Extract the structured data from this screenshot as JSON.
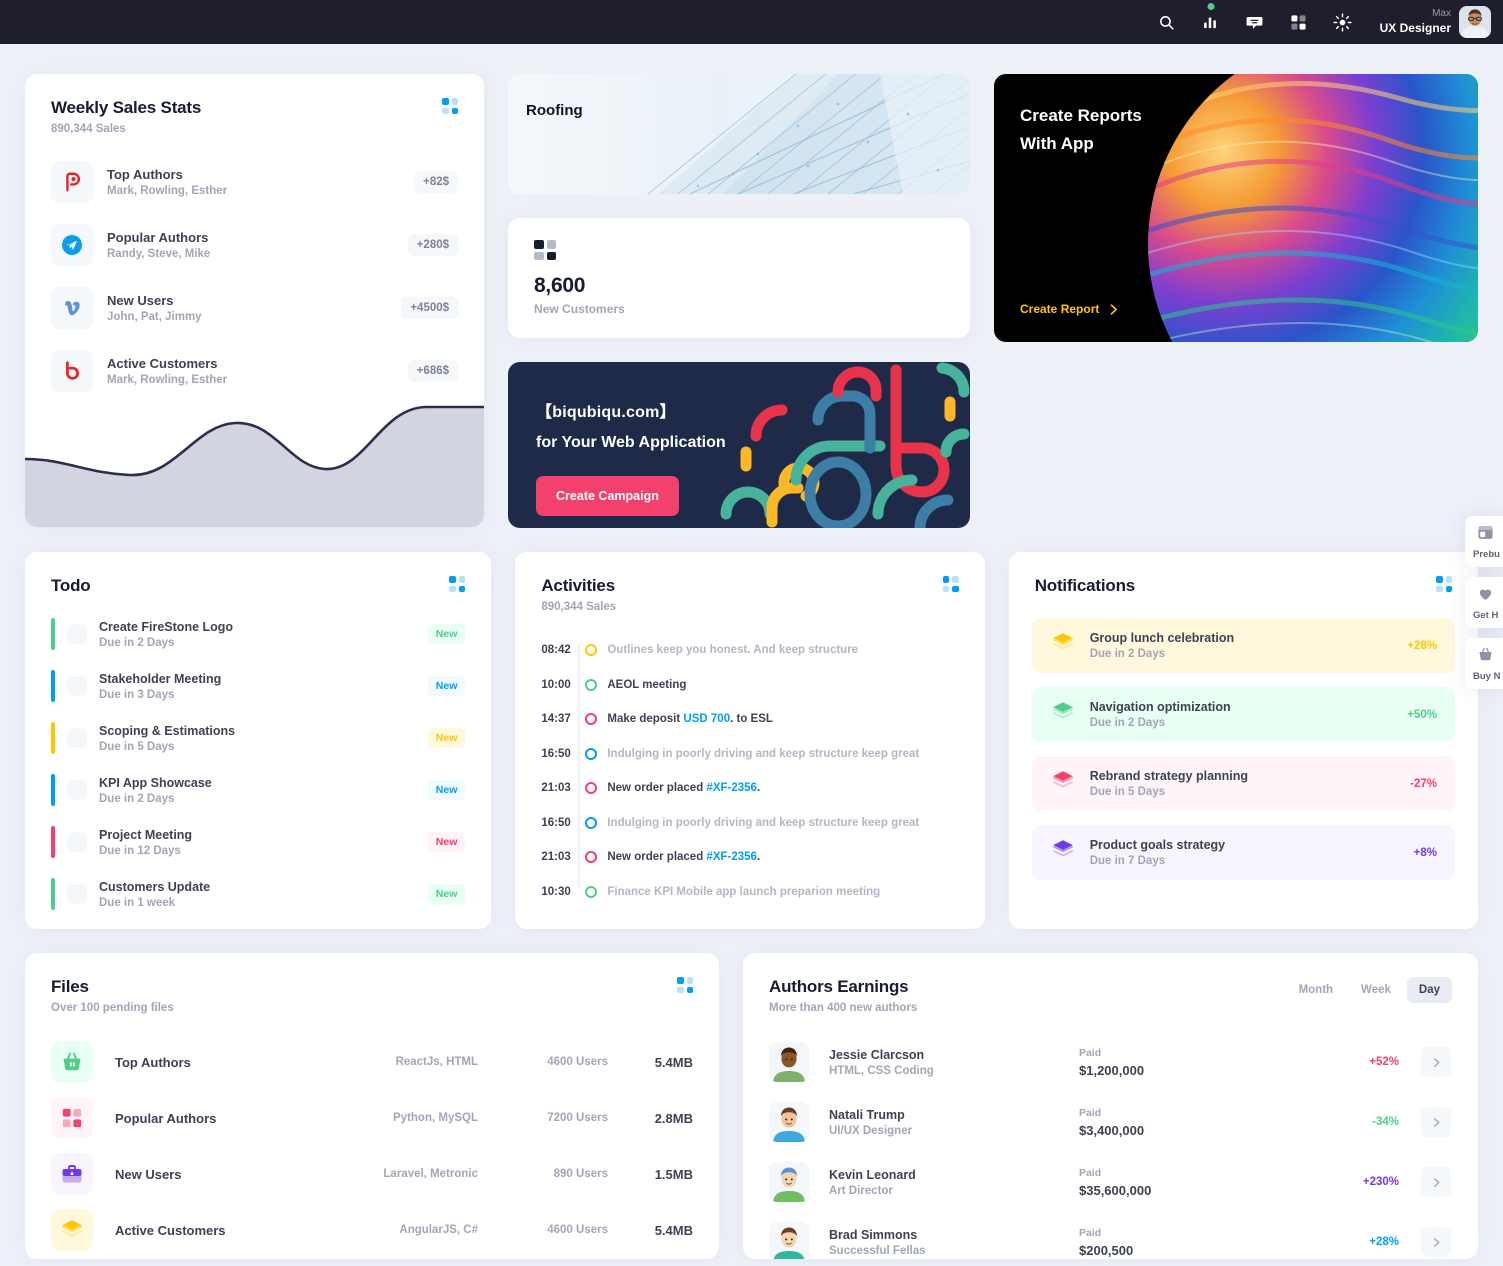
{
  "header": {
    "icons": [
      "search-icon",
      "bar-chart-icon",
      "chat-bubble-icon",
      "grid-icon",
      "brightness-icon"
    ],
    "greeting": "Max",
    "role": "UX Designer"
  },
  "weekly_sales": {
    "title": "Weekly Sales Stats",
    "subtitle": "890,344 Sales",
    "menu_icon": "grid-dots-icon",
    "items": [
      {
        "icon": "plurk-icon",
        "name": "Top Authors",
        "people": "Mark, Rowling, Esther",
        "amount": "+82$"
      },
      {
        "icon": "telegram-icon",
        "name": "Popular Authors",
        "people": "Randy, Steve, Mike",
        "amount": "+280$"
      },
      {
        "icon": "vimeo-icon",
        "name": "New Users",
        "people": "John, Pat, Jimmy",
        "amount": "+4500$"
      },
      {
        "icon": "bebo-icon",
        "name": "Active Customers",
        "people": "Mark, Rowling, Esther",
        "amount": "+686$"
      }
    ],
    "chart_data": {
      "type": "area",
      "title": "Weekly Sales Stats",
      "x": [
        0,
        1,
        2,
        3,
        4,
        5,
        6,
        7,
        8
      ],
      "values": [
        42,
        37,
        31,
        48,
        62,
        55,
        38,
        44,
        78
      ],
      "stroke_color": "#2b2f4c",
      "fill_color": "#d2d4e0",
      "grid": false,
      "xlabel": "",
      "ylabel": "",
      "ylim": [
        0,
        100
      ]
    }
  },
  "roofing": {
    "title": "Roofing",
    "image": "glass-building-facade"
  },
  "new_customers": {
    "icon": "checker-grid-icon",
    "value": "8,600",
    "label": "New Customers"
  },
  "reports": {
    "line1": "Create Reports",
    "line2": "With App",
    "cta": "Create Report",
    "cta_icon": "arrow-right-icon",
    "accent": "#ffc700",
    "image": "iridescent-sphere"
  },
  "campaign": {
    "line1": "【biqubiqu.com】",
    "line2": "for Your Web Application",
    "button": "Create Campaign",
    "button_color": "#f1416c",
    "bg_color": "#1e2a47"
  },
  "todo": {
    "title": "Todo",
    "menu_icon": "grid-dots-icon",
    "items": [
      {
        "name": "Create FireStone Logo",
        "due": "Due in 2 Days",
        "badge": "New",
        "color": "#50cd89"
      },
      {
        "name": "Stakeholder Meeting",
        "due": "Due in 3 Days",
        "badge": "New",
        "color": "#009ef7"
      },
      {
        "name": "Scoping & Estimations",
        "due": "Due in 5 Days",
        "badge": "New",
        "color": "#ffc700"
      },
      {
        "name": "KPI App Showcase",
        "due": "Due in 2 Days",
        "badge": "New",
        "color": "#009ef7"
      },
      {
        "name": "Project Meeting",
        "due": "Due in 12 Days",
        "badge": "New",
        "color": "#f1416c"
      },
      {
        "name": "Customers Update",
        "due": "Due in 1 week",
        "badge": "New",
        "color": "#50cd89"
      }
    ]
  },
  "activities": {
    "title": "Activities",
    "subtitle": "890,344 Sales",
    "menu_icon": "grid-dots-icon",
    "items": [
      {
        "time": "08:42",
        "color": "#ffc700",
        "text": "Outlines keep you honest. And keep structure",
        "muted": true
      },
      {
        "time": "10:00",
        "color": "#50cd89",
        "text": "AEOL meeting",
        "muted": false
      },
      {
        "time": "14:37",
        "color": "#f1416c",
        "text": "Make deposit USD 700. to ESL",
        "muted": false,
        "link": "USD 700"
      },
      {
        "time": "16:50",
        "color": "#009ef7",
        "text": "Indulging in poorly driving and keep structure keep great",
        "muted": true
      },
      {
        "time": "21:03",
        "color": "#f1416c",
        "text": "New order placed #XF-2356.",
        "muted": false,
        "link": "#XF-2356"
      },
      {
        "time": "16:50",
        "color": "#009ef7",
        "text": "Indulging in poorly driving and keep structure keep great",
        "muted": true
      },
      {
        "time": "21:03",
        "color": "#f1416c",
        "text": "New order placed #XF-2356.",
        "muted": false,
        "link": "#XF-2356"
      },
      {
        "time": "10:30",
        "color": "#50cd89",
        "text": "Finance KPI Mobile app launch preparion meeting",
        "muted": true
      }
    ]
  },
  "notifications": {
    "title": "Notifications",
    "menu_icon": "grid-dots-icon",
    "items": [
      {
        "icon": "layers-icon",
        "name": "Group lunch celebration",
        "due": "Due in 2 Days",
        "pct": "+28%",
        "color": "#ffc700",
        "bg": "#fff8dd"
      },
      {
        "icon": "layers-icon",
        "name": "Navigation optimization",
        "due": "Due in 2 Days",
        "pct": "+50%",
        "color": "#50cd89",
        "bg": "#e8fff3"
      },
      {
        "icon": "layers-icon",
        "name": "Rebrand strategy planning",
        "due": "Due in 5 Days",
        "pct": "-27%",
        "color": "#f1416c",
        "bg": "#fff5f8"
      },
      {
        "icon": "layers-icon",
        "name": "Product goals strategy",
        "due": "Due in 7 Days",
        "pct": "+8%",
        "color": "#7239ea",
        "bg": "#f8f5ff"
      }
    ]
  },
  "files": {
    "title": "Files",
    "subtitle": "Over 100 pending files",
    "menu_icon": "grid-dots-icon",
    "items": [
      {
        "icon": "basket-icon",
        "name": "Top Authors",
        "tech": "ReactJs, HTML",
        "users": "4600 Users",
        "size": "5.4MB",
        "color": "#50cd89",
        "bg": "#e8fff3"
      },
      {
        "icon": "grid-icon",
        "name": "Popular Authors",
        "tech": "Python, MySQL",
        "users": "7200 Users",
        "size": "2.8MB",
        "color": "#f1416c",
        "bg": "#fff5f8"
      },
      {
        "icon": "briefcase-icon",
        "name": "New Users",
        "tech": "Laravel, Metronic",
        "users": "890 Users",
        "size": "1.5MB",
        "color": "#7239ea",
        "bg": "#f8f5ff"
      },
      {
        "icon": "layers-icon",
        "name": "Active Customers",
        "tech": "AngularJS, C#",
        "users": "4600 Users",
        "size": "5.4MB",
        "color": "#ffc700",
        "bg": "#fff8dd"
      }
    ]
  },
  "authors": {
    "title": "Authors Earnings",
    "subtitle": "More than 400 new authors",
    "tabs": [
      "Month",
      "Week",
      "Day"
    ],
    "active_tab": "Day",
    "paid_label": "Paid",
    "items": [
      {
        "avatar": "avatar-woman-dark",
        "name": "Jessie Clarcson",
        "role": "HTML, CSS Coding",
        "paid": "$1,200,000",
        "pct": "+52%",
        "pct_color": "#f1416c"
      },
      {
        "avatar": "avatar-woman-brown",
        "name": "Natali Trump",
        "role": "UI/UX Designer",
        "paid": "$3,400,000",
        "pct": "-34%",
        "pct_color": "#50cd89"
      },
      {
        "avatar": "avatar-man-blue",
        "name": "Kevin Leonard",
        "role": "Art Director",
        "paid": "$35,600,000",
        "pct": "+230%",
        "pct_color": "#7239ea"
      },
      {
        "avatar": "avatar-man-green",
        "name": "Brad Simmons",
        "role": "Successful Fellas",
        "paid": "$200,500",
        "pct": "+28%",
        "pct_color": "#009ef7"
      }
    ]
  },
  "float_bar": [
    {
      "icon": "layout-icon",
      "label": "Prebu"
    },
    {
      "icon": "heart-hand-icon",
      "label": "Get H"
    },
    {
      "icon": "basket-icon",
      "label": "Buy N"
    }
  ]
}
